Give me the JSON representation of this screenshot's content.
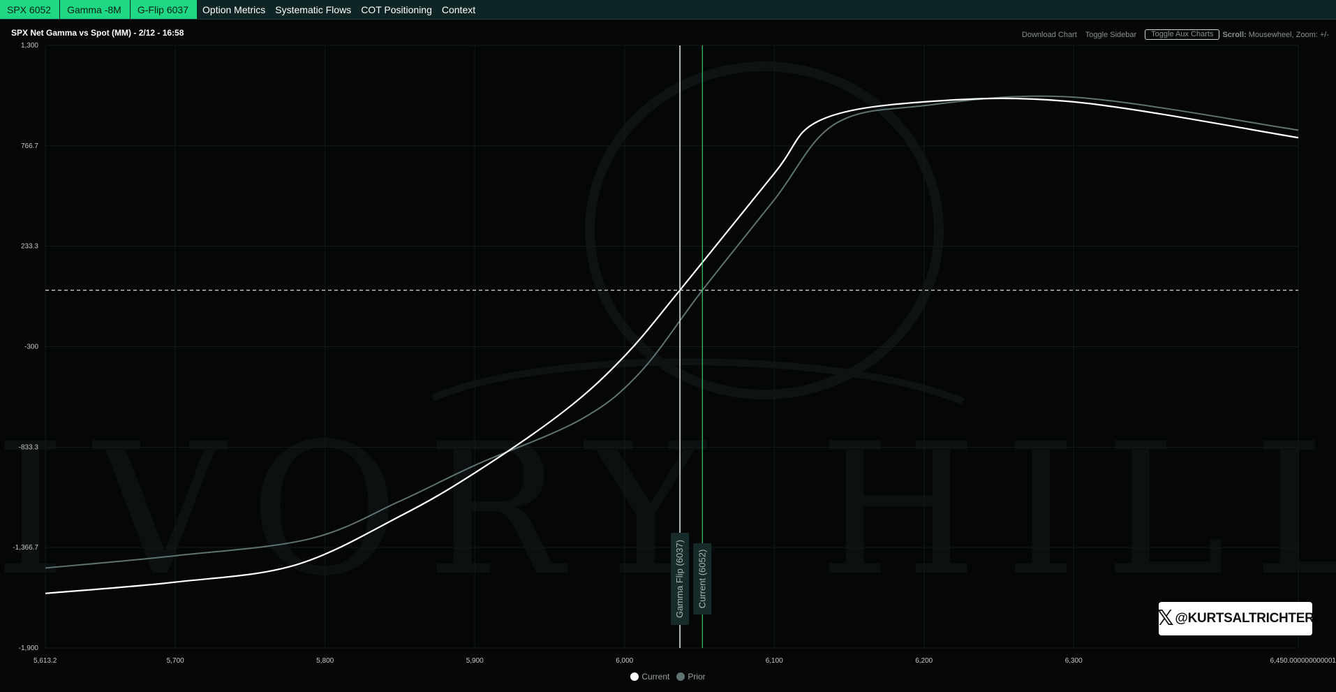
{
  "topbar": {
    "pills": [
      {
        "label": "SPX 6052"
      },
      {
        "label": "Gamma -8M"
      },
      {
        "label": "G-Flip 6037"
      }
    ],
    "nav": [
      {
        "label": "Option Metrics"
      },
      {
        "label": "Systematic Flows"
      },
      {
        "label": "COT Positioning"
      },
      {
        "label": "Context"
      }
    ]
  },
  "toolbar": {
    "download": "Download Chart",
    "sidebar": "Toggle Sidebar",
    "aux": "Toggle Aux Charts",
    "hint_bold": "Scroll:",
    "hint_rest": " Mousewheel, Zoom: +/-"
  },
  "badge": {
    "handle": "@KURTSALTRICHTER",
    "logo_icon": "x-logo-icon"
  },
  "watermark": {
    "text": "IVORY HILL"
  },
  "colors": {
    "accent": "#1fd883",
    "current": "#ffffff",
    "prior": "#5e7372",
    "spot_line": "#3fd96a"
  },
  "chart_data": {
    "type": "line",
    "title": "SPX Net Gamma vs Spot (MM) - 2/12 - 16:58",
    "xlabel": "",
    "ylabel": "",
    "xlim": [
      5613.2,
      6450.000000000001
    ],
    "ylim": [
      -1900,
      1300
    ],
    "x_ticks": [
      5613.2,
      5700,
      5800,
      5900,
      6000,
      6100,
      6200,
      6300,
      6450.000000000001
    ],
    "x_tick_labels": [
      "5,613.2",
      "5,700",
      "5,800",
      "5,900",
      "6,000",
      "6,100",
      "6,200",
      "6,300",
      "6,450.000000000001"
    ],
    "y_ticks": [
      1300,
      766.7,
      233.3,
      -300,
      -833.3,
      -1366.7,
      -1900
    ],
    "y_tick_labels": [
      "1,300",
      "766.7",
      "233.3",
      "-300",
      "-833.3",
      "-1,366.7",
      "-1,900"
    ],
    "grid": true,
    "legend_position": "bottom-center",
    "zero_line": 0,
    "series": [
      {
        "name": "Current",
        "x": [
          5613.2,
          5700,
          5780,
          5850,
          5900,
          5960,
          6000,
          6037,
          6100,
          6130,
          6200,
          6300,
          6450
        ],
        "y": [
          -1610,
          -1550,
          -1460,
          -1200,
          -970,
          -640,
          -350,
          0,
          620,
          900,
          1000,
          1000,
          810
        ]
      },
      {
        "name": "Prior",
        "x": [
          5613.2,
          5700,
          5790,
          5850,
          5900,
          5970,
          6010,
          6052,
          6100,
          6140,
          6200,
          6300,
          6450
        ],
        "y": [
          -1475,
          -1410,
          -1320,
          -1120,
          -930,
          -690,
          -440,
          0,
          480,
          880,
          980,
          1025,
          850
        ]
      }
    ],
    "annotations": [
      {
        "label": "Gamma Flip (6037)",
        "x": 6037
      },
      {
        "label": "Current (6052)",
        "x": 6052
      }
    ]
  }
}
